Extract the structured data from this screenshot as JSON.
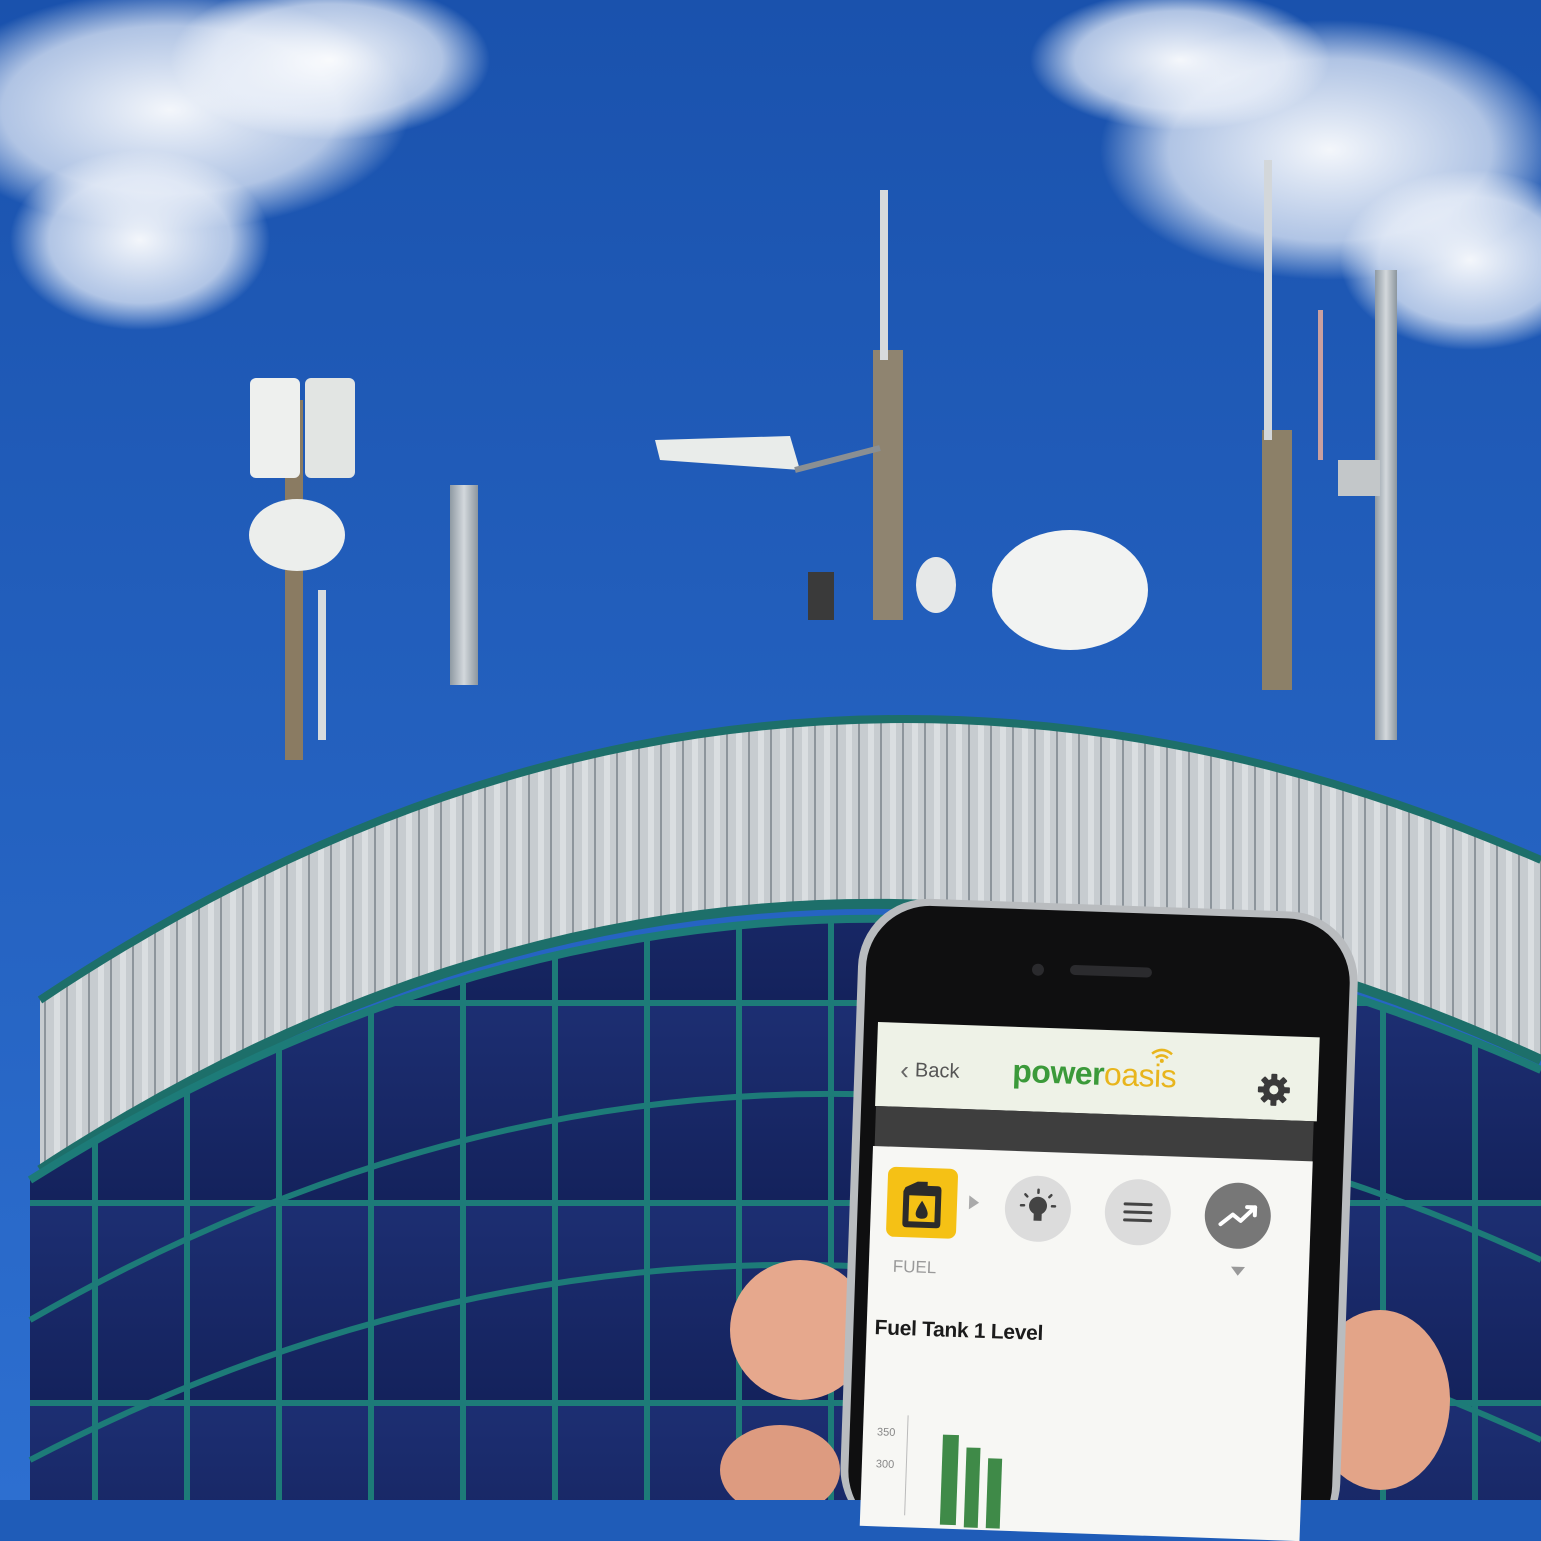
{
  "app": {
    "back_label": "Back",
    "logo_part1": "power",
    "logo_part2": "oasis",
    "tiles": [
      {
        "label": "FUEL",
        "icon": "fuel-can-icon",
        "selected": true,
        "color": "#f5c115"
      },
      {
        "label": "",
        "icon": "lightbulb-icon",
        "selected": false
      },
      {
        "label": "",
        "icon": "list-menu-icon",
        "selected": false
      },
      {
        "label": "",
        "icon": "trend-chart-icon",
        "selected": false
      }
    ],
    "chart": {
      "title": "Fuel Tank 1 Level",
      "y_ticks": [
        "350",
        "300"
      ]
    }
  },
  "colors": {
    "brand_green": "#3b9a3a",
    "brand_yellow": "#e8b51d",
    "bar_green": "#3f8a48"
  }
}
